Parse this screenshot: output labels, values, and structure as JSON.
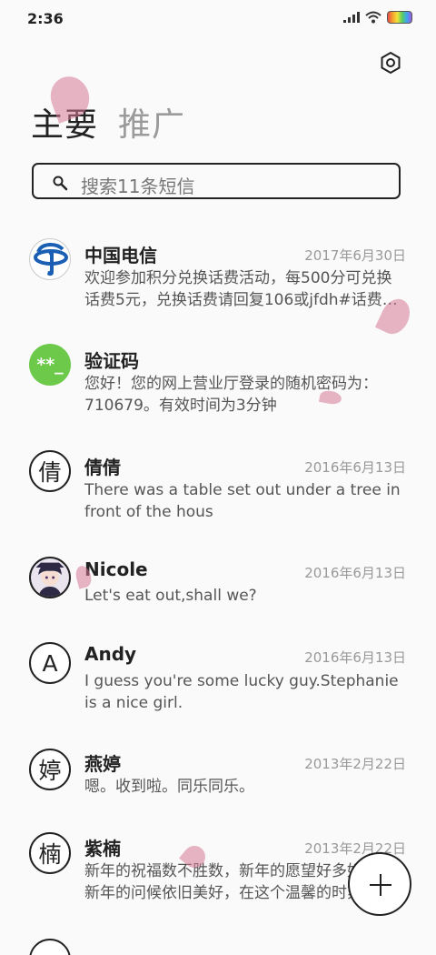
{
  "status": {
    "time": "2:36"
  },
  "tabs": [
    {
      "label": "主要",
      "active": true
    },
    {
      "label": "推广",
      "active": false
    }
  ],
  "search": {
    "placeholder": "搜索11条短信"
  },
  "conversations": [
    {
      "name": "中国电信",
      "date": "2017年6月30日",
      "preview": [
        "欢迎参加积分兑换话费活动，每500分可兑换",
        "话费5元，兑换话费请回复106或jfdh#话费…"
      ],
      "avatar": "china-telecom-logo"
    },
    {
      "name": "验证码",
      "date": "",
      "preview": [
        "您好！您的网上营业厅登录的随机密码为：",
        "710679。有效时间为3分钟"
      ],
      "avatar_text": "**_"
    },
    {
      "name": "倩倩",
      "date": "2016年6月13日",
      "preview": [
        "There was a table set out under a tree in",
        "front of the hous"
      ],
      "avatar_text": "倩"
    },
    {
      "name": "Nicole",
      "date": "2016年6月13日",
      "preview": [
        "Let's eat out,shall we?"
      ],
      "avatar": "photo"
    },
    {
      "name": "Andy",
      "date": "2016年6月13日",
      "preview": [
        "I guess you're some lucky guy.Stephanie",
        "is a nice girl."
      ],
      "avatar_text": "A"
    },
    {
      "name": "燕婷",
      "date": "2013年2月22日",
      "preview": [
        "嗯。收到啦。同乐同乐。"
      ],
      "avatar_text": "婷"
    },
    {
      "name": "紫楠",
      "date": "2013年2月22日",
      "preview": [
        "新年的祝福数不胜数，新年的愿望好多好多",
        "新年的问候依旧美好，在这个温馨的时刻"
      ],
      "avatar_text": "楠"
    }
  ],
  "colors": {
    "accent": "#222222",
    "verify_avatar": "#6cc94a",
    "telecom_blue": "#1a5fb4"
  }
}
